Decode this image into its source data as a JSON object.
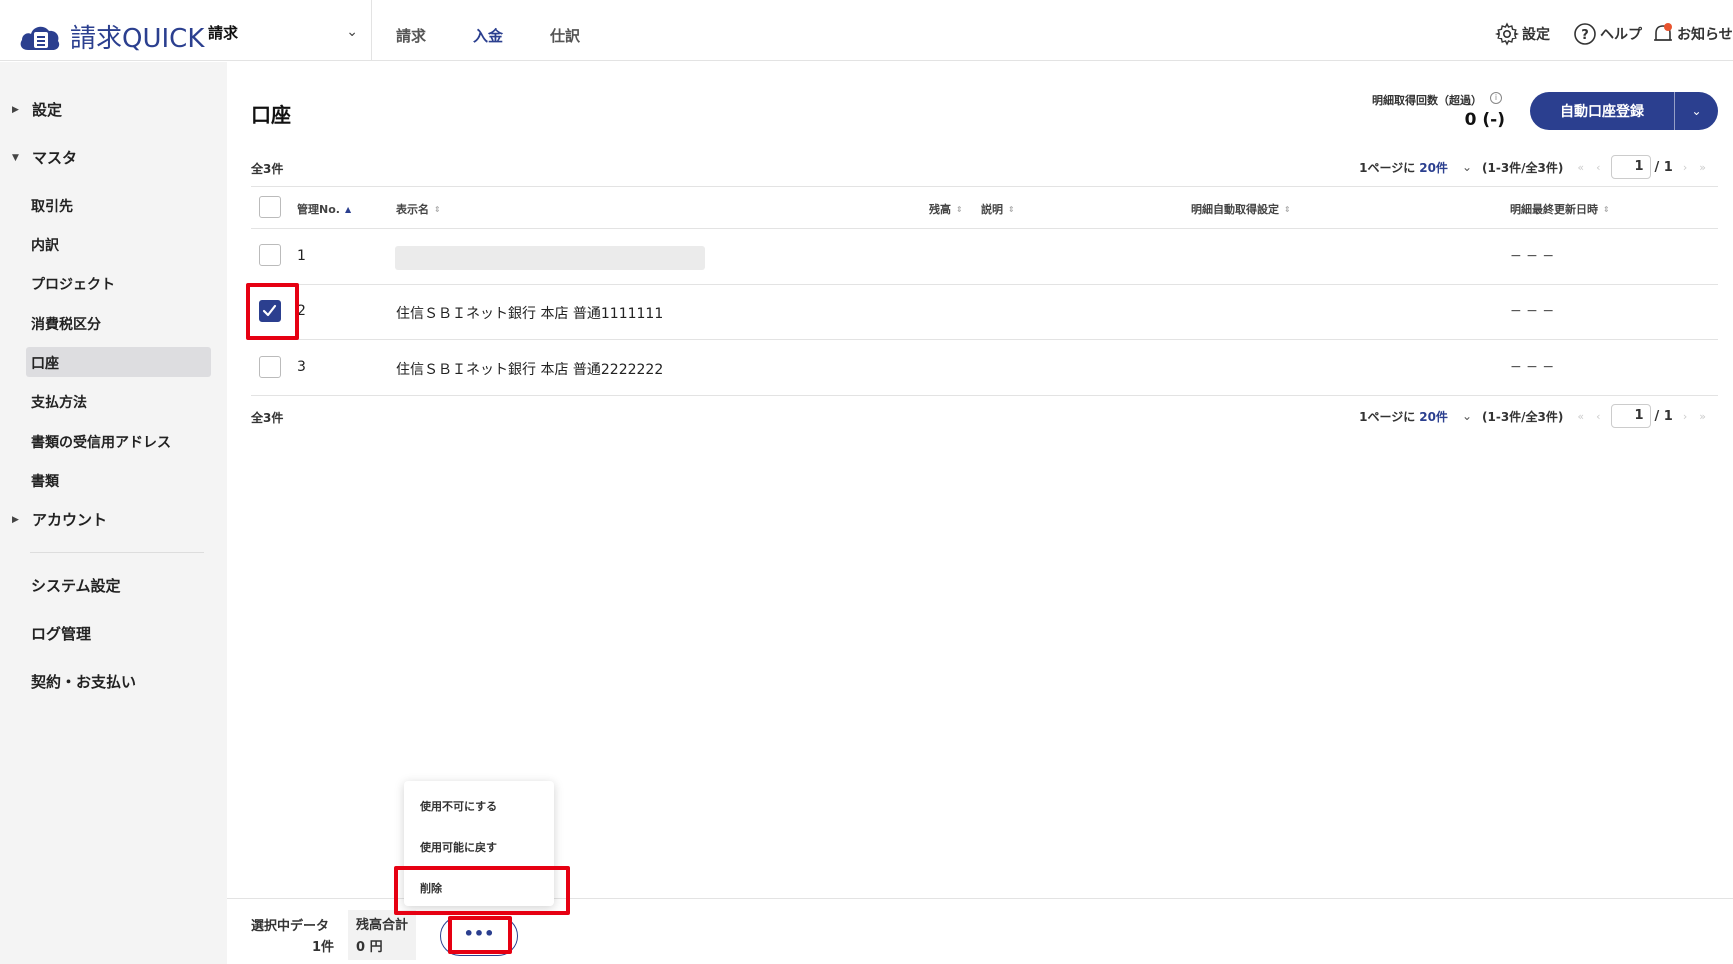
{
  "header": {
    "logo_text": "請求QUICK",
    "app_select": "請求",
    "tabs": [
      {
        "label": "請求",
        "active": false
      },
      {
        "label": "入金",
        "active": true
      },
      {
        "label": "仕訳",
        "active": false
      }
    ],
    "settings_label": "設定",
    "help_label": "ヘルプ",
    "notice_label": "お知らせ"
  },
  "sidebar": {
    "group_settings": "設定",
    "group_master": "マスタ",
    "items": [
      "取引先",
      "内訳",
      "プロジェクト",
      "消費税区分",
      "口座",
      "支払方法",
      "書類の受信用アドレス",
      "書類"
    ],
    "active_item": "口座",
    "group_account": "アカウント",
    "system_settings": "システム設定",
    "log_management": "ログ管理",
    "contract": "契約・お支払い"
  },
  "main": {
    "title": "口座",
    "quota_label": "明細取得回数（超過）",
    "quota_value": "0 (-)",
    "primary_button": "自動口座登録",
    "total_count": "全3件",
    "pager": {
      "per_page_prefix": "1ページに",
      "per_page_value": "20件",
      "range": "(1-3件/全3件)",
      "current_page": "1",
      "total_pages": "/ 1"
    },
    "columns": [
      "管理No.",
      "表示名",
      "残高",
      "説明",
      "明細自動取得設定",
      "明細最終更新日時"
    ],
    "rows": [
      {
        "no": "1",
        "name": "",
        "updated": "− − −",
        "checked": false
      },
      {
        "no": "2",
        "name": "住信ＳＢＩネット銀行 本店 普通1111111",
        "updated": "− − −",
        "checked": true
      },
      {
        "no": "3",
        "name": "住信ＳＢＩネット銀行 本店 普通2222222",
        "updated": "− − −",
        "checked": false
      }
    ]
  },
  "bottom": {
    "selected_label": "選択中データ",
    "selected_count": "1件",
    "balance_label": "残高合計",
    "balance_value": "0 円",
    "more_label": "•••"
  },
  "popup_menu": {
    "items": [
      "使用不可にする",
      "使用可能に戻す",
      "削除"
    ]
  },
  "colors": {
    "brand": "#2b3f8f",
    "highlight": "#e60012"
  }
}
